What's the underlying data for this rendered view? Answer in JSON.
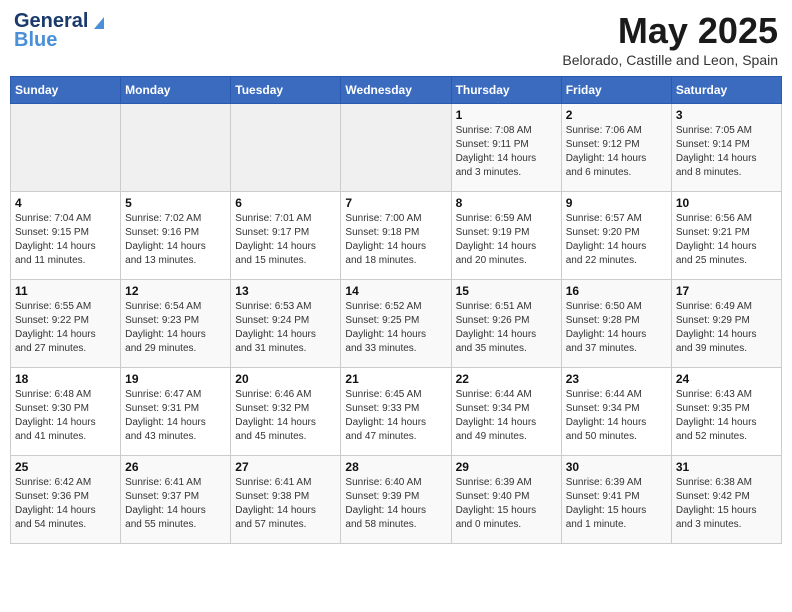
{
  "header": {
    "logo_line1": "General",
    "logo_line2": "Blue",
    "month": "May 2025",
    "location": "Belorado, Castille and Leon, Spain"
  },
  "days_of_week": [
    "Sunday",
    "Monday",
    "Tuesday",
    "Wednesday",
    "Thursday",
    "Friday",
    "Saturday"
  ],
  "weeks": [
    [
      {
        "day": "",
        "info": ""
      },
      {
        "day": "",
        "info": ""
      },
      {
        "day": "",
        "info": ""
      },
      {
        "day": "",
        "info": ""
      },
      {
        "day": "1",
        "info": "Sunrise: 7:08 AM\nSunset: 9:11 PM\nDaylight: 14 hours\nand 3 minutes."
      },
      {
        "day": "2",
        "info": "Sunrise: 7:06 AM\nSunset: 9:12 PM\nDaylight: 14 hours\nand 6 minutes."
      },
      {
        "day": "3",
        "info": "Sunrise: 7:05 AM\nSunset: 9:14 PM\nDaylight: 14 hours\nand 8 minutes."
      }
    ],
    [
      {
        "day": "4",
        "info": "Sunrise: 7:04 AM\nSunset: 9:15 PM\nDaylight: 14 hours\nand 11 minutes."
      },
      {
        "day": "5",
        "info": "Sunrise: 7:02 AM\nSunset: 9:16 PM\nDaylight: 14 hours\nand 13 minutes."
      },
      {
        "day": "6",
        "info": "Sunrise: 7:01 AM\nSunset: 9:17 PM\nDaylight: 14 hours\nand 15 minutes."
      },
      {
        "day": "7",
        "info": "Sunrise: 7:00 AM\nSunset: 9:18 PM\nDaylight: 14 hours\nand 18 minutes."
      },
      {
        "day": "8",
        "info": "Sunrise: 6:59 AM\nSunset: 9:19 PM\nDaylight: 14 hours\nand 20 minutes."
      },
      {
        "day": "9",
        "info": "Sunrise: 6:57 AM\nSunset: 9:20 PM\nDaylight: 14 hours\nand 22 minutes."
      },
      {
        "day": "10",
        "info": "Sunrise: 6:56 AM\nSunset: 9:21 PM\nDaylight: 14 hours\nand 25 minutes."
      }
    ],
    [
      {
        "day": "11",
        "info": "Sunrise: 6:55 AM\nSunset: 9:22 PM\nDaylight: 14 hours\nand 27 minutes."
      },
      {
        "day": "12",
        "info": "Sunrise: 6:54 AM\nSunset: 9:23 PM\nDaylight: 14 hours\nand 29 minutes."
      },
      {
        "day": "13",
        "info": "Sunrise: 6:53 AM\nSunset: 9:24 PM\nDaylight: 14 hours\nand 31 minutes."
      },
      {
        "day": "14",
        "info": "Sunrise: 6:52 AM\nSunset: 9:25 PM\nDaylight: 14 hours\nand 33 minutes."
      },
      {
        "day": "15",
        "info": "Sunrise: 6:51 AM\nSunset: 9:26 PM\nDaylight: 14 hours\nand 35 minutes."
      },
      {
        "day": "16",
        "info": "Sunrise: 6:50 AM\nSunset: 9:28 PM\nDaylight: 14 hours\nand 37 minutes."
      },
      {
        "day": "17",
        "info": "Sunrise: 6:49 AM\nSunset: 9:29 PM\nDaylight: 14 hours\nand 39 minutes."
      }
    ],
    [
      {
        "day": "18",
        "info": "Sunrise: 6:48 AM\nSunset: 9:30 PM\nDaylight: 14 hours\nand 41 minutes."
      },
      {
        "day": "19",
        "info": "Sunrise: 6:47 AM\nSunset: 9:31 PM\nDaylight: 14 hours\nand 43 minutes."
      },
      {
        "day": "20",
        "info": "Sunrise: 6:46 AM\nSunset: 9:32 PM\nDaylight: 14 hours\nand 45 minutes."
      },
      {
        "day": "21",
        "info": "Sunrise: 6:45 AM\nSunset: 9:33 PM\nDaylight: 14 hours\nand 47 minutes."
      },
      {
        "day": "22",
        "info": "Sunrise: 6:44 AM\nSunset: 9:34 PM\nDaylight: 14 hours\nand 49 minutes."
      },
      {
        "day": "23",
        "info": "Sunrise: 6:44 AM\nSunset: 9:34 PM\nDaylight: 14 hours\nand 50 minutes."
      },
      {
        "day": "24",
        "info": "Sunrise: 6:43 AM\nSunset: 9:35 PM\nDaylight: 14 hours\nand 52 minutes."
      }
    ],
    [
      {
        "day": "25",
        "info": "Sunrise: 6:42 AM\nSunset: 9:36 PM\nDaylight: 14 hours\nand 54 minutes."
      },
      {
        "day": "26",
        "info": "Sunrise: 6:41 AM\nSunset: 9:37 PM\nDaylight: 14 hours\nand 55 minutes."
      },
      {
        "day": "27",
        "info": "Sunrise: 6:41 AM\nSunset: 9:38 PM\nDaylight: 14 hours\nand 57 minutes."
      },
      {
        "day": "28",
        "info": "Sunrise: 6:40 AM\nSunset: 9:39 PM\nDaylight: 14 hours\nand 58 minutes."
      },
      {
        "day": "29",
        "info": "Sunrise: 6:39 AM\nSunset: 9:40 PM\nDaylight: 15 hours\nand 0 minutes."
      },
      {
        "day": "30",
        "info": "Sunrise: 6:39 AM\nSunset: 9:41 PM\nDaylight: 15 hours\nand 1 minute."
      },
      {
        "day": "31",
        "info": "Sunrise: 6:38 AM\nSunset: 9:42 PM\nDaylight: 15 hours\nand 3 minutes."
      }
    ]
  ]
}
